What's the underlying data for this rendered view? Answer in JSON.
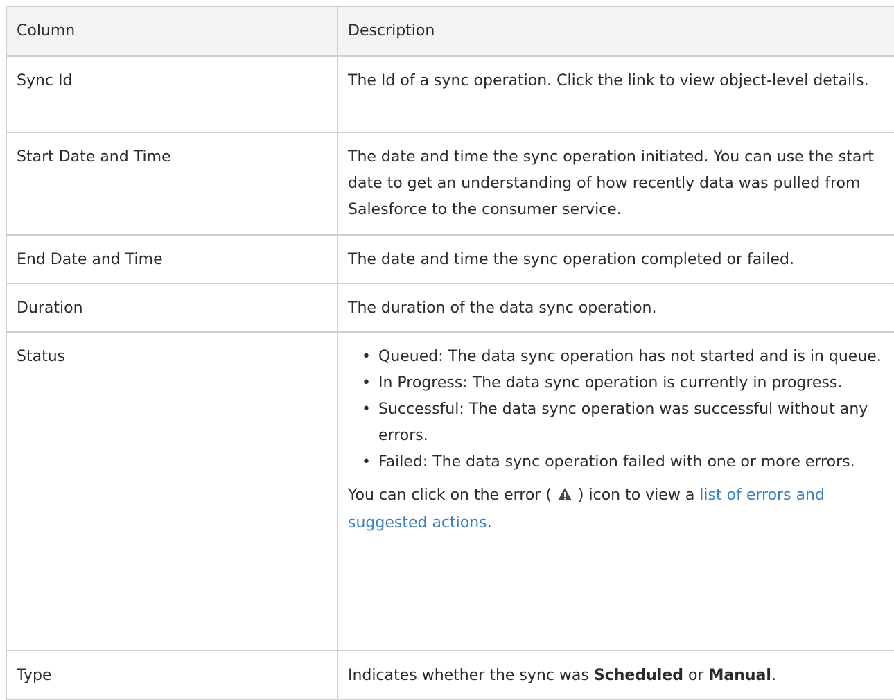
{
  "table": {
    "headers": [
      "Column",
      "Description"
    ],
    "rows": [
      {
        "column": "Sync Id",
        "description": "The Id of a sync operation. Click the link to view object-level details."
      },
      {
        "column": "Start Date and Time",
        "description": "The date and time the sync operation initiated. You can use the start date to get an understanding of how recently data was pulled from Salesforce to the consumer service."
      },
      {
        "column": "End Date and Time",
        "description": "The date and time the sync operation completed or failed."
      },
      {
        "column": "Duration",
        "description": "The duration of the data sync operation."
      },
      {
        "column": "Status",
        "statuses": [
          "Queued: The data sync operation has not started and is in queue.",
          "In Progress: The data sync operation is currently in progress.",
          "Successful: The data sync operation was successful without any errors.",
          "Failed: The data sync operation failed with one or more errors."
        ],
        "note_before_icon": "You can click on the error (",
        "note_after_icon": ") icon to view a",
        "note_link": "list of errors and suggested actions",
        "note_end": "."
      },
      {
        "column": "Type",
        "type_prefix": "Indicates whether the sync was",
        "scheduled": "Scheduled",
        "or": "or",
        "manual": "Manual",
        "period": "."
      }
    ]
  },
  "bullet_glyph": "•",
  "icons": {
    "error": "warning-triangle-icon"
  },
  "colors": {
    "link": "#3a7fbf",
    "header_bg": "#f3f3f3",
    "border": "#cfcfcf",
    "icon": "#4a4a4a"
  }
}
